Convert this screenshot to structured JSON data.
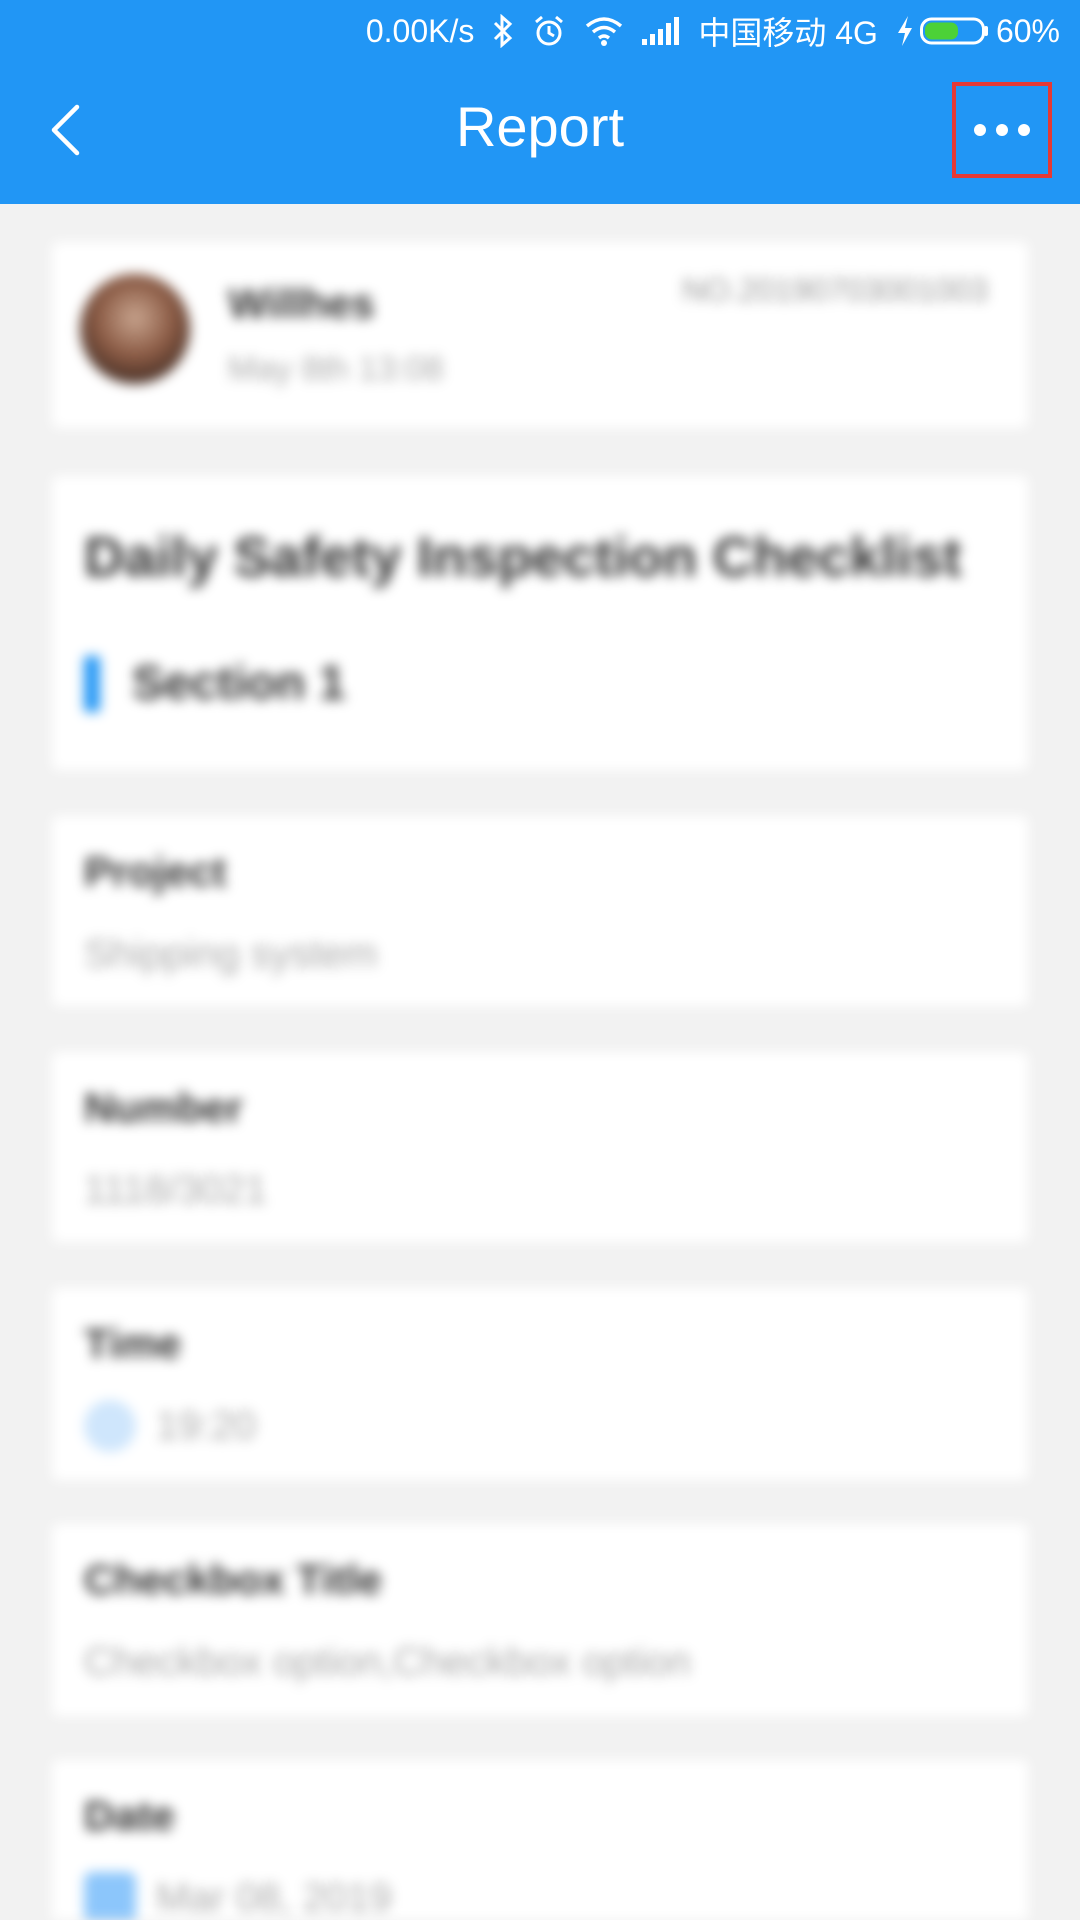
{
  "status_bar": {
    "network_speed": "0.00K/s",
    "carrier": "中国移动 4G",
    "battery": "60%",
    "battery_level": 0.6,
    "icons": [
      "bluetooth-icon",
      "alarm-icon",
      "wifi-icon",
      "signal-icon",
      "charging-icon",
      "battery-icon"
    ]
  },
  "app_bar": {
    "title": "Report",
    "back_icon": "chevron-left-icon",
    "more_icon": "more-horizontal-icon",
    "highlight_color": "#e53935"
  },
  "colors": {
    "primary": "#2196f5",
    "background": "#f2f2f2"
  },
  "author": {
    "name": "Willhes",
    "date": "May 8th 13:08",
    "report_no": "NO.20190703001003"
  },
  "report": {
    "title": "Daily Safety Inspection Checklist",
    "section": "Section 1"
  },
  "fields": [
    {
      "label": "Project",
      "value": "Shipping system"
    },
    {
      "label": "Number",
      "value": "1118/3021"
    },
    {
      "label": "Time",
      "value": "19:20"
    },
    {
      "label": "Checkbox Title",
      "value": "Checkbox option,Checkbox option"
    },
    {
      "label": "Date",
      "value": "Mar 08, 2019"
    }
  ]
}
